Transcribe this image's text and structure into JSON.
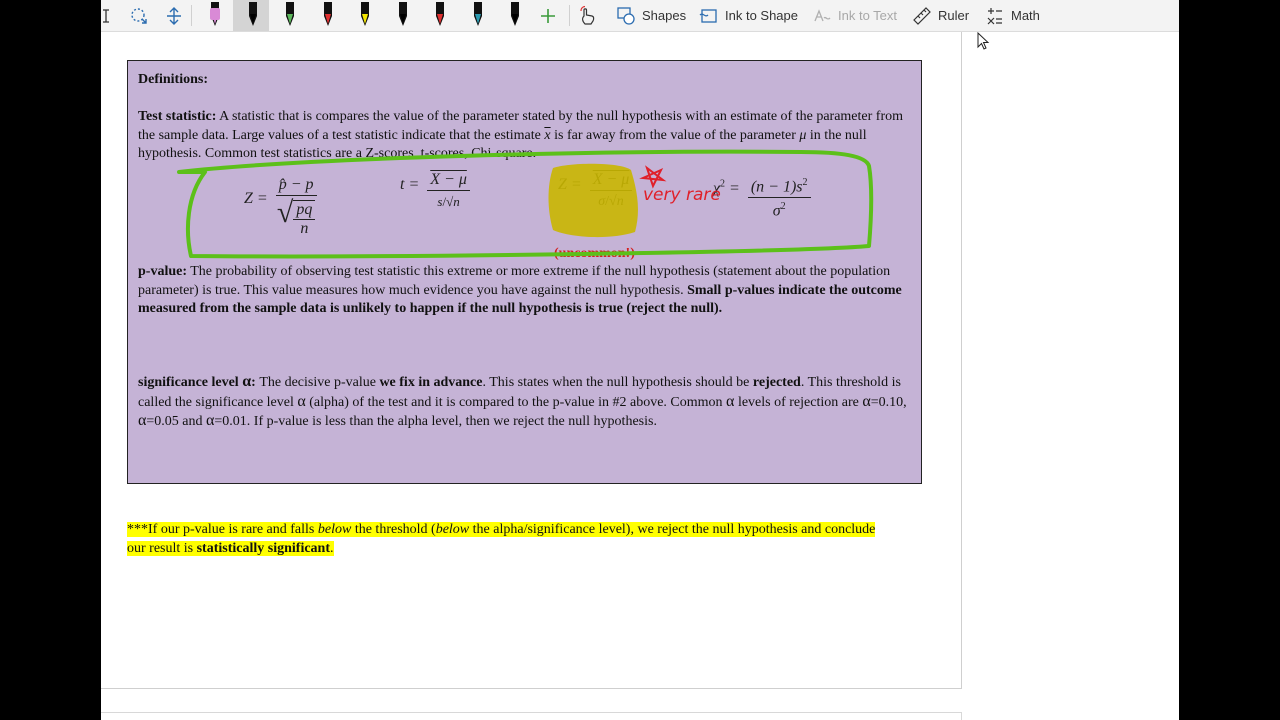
{
  "toolbar": {
    "shapes_label": "Shapes",
    "ink_to_shape_label": "Ink to Shape",
    "ink_to_text_label": "Ink to Text",
    "ruler_label": "Ruler",
    "math_label": "Math",
    "pens": [
      {
        "name": "pen-pink",
        "color": "#d98ad6"
      },
      {
        "name": "pen-black-selected",
        "color": "#000000"
      },
      {
        "name": "pen-green",
        "color": "#5cb85c"
      },
      {
        "name": "pen-red",
        "color": "#e03030"
      },
      {
        "name": "highlighter-yellow",
        "color": "#f3e600"
      },
      {
        "name": "pen-black-2",
        "color": "#000000"
      },
      {
        "name": "pen-red-2",
        "color": "#e03030"
      },
      {
        "name": "pen-teal",
        "color": "#2a9ab0"
      },
      {
        "name": "pen-black-3",
        "color": "#000000"
      }
    ]
  },
  "definitions": {
    "heading": "Definitions:",
    "test_statistic": {
      "term": "Test statistic:",
      "text_1": " A statistic that is compares the value of the parameter stated by the null hypothesis with an estimate of the parameter from the sample data.  Large values of a test statistic indicate that the estimate ",
      "xbar": "x",
      "text_2": "  is far away from the value of the parameter  ",
      "mu": "μ",
      "text_3": " in the null hypothesis.  Common test statistics are a Z-scores, t-scores, Chi-square."
    },
    "formulas": {
      "z_prop_lhs": "Z =",
      "z_prop_num": "p̂ − p",
      "z_prop_den": "pq",
      "z_prop_den_n": "n",
      "t_lhs": "t =",
      "t_num": "X − μ",
      "t_den_s": "s",
      "t_den_n": "n",
      "z_mean_lhs": "Z =",
      "z_mean_num": "X − μ",
      "z_mean_den_sigma": "σ",
      "z_mean_den_n": "n",
      "chi_lhs": "χ",
      "chi_sup": "2",
      "chi_eq": " =",
      "chi_num": "(n − 1)s",
      "chi_num_sup": "2",
      "chi_den": "σ",
      "chi_den_sup": "2",
      "uncommon": "(uncommon!)"
    },
    "p_value": {
      "term": "p-value:",
      "text_1": "  The probability of observing  test statistic this extreme or more extreme if the null hypothesis (statement about the population parameter) is true.  This value measures how much evidence you have against the null hypothesis.  ",
      "bold_text": "Small p-values indicate the outcome measured from the sample data is unlikely to happen if the null hypothesis is true (reject the null)."
    },
    "significance": {
      "term": "significance level ",
      "alpha": "α",
      "colon": ":",
      "text_1": "  The decisive p-value ",
      "bold_1": "we fix in advance",
      "text_2": ".  This states when the null hypothesis should be ",
      "bold_2": "rejected",
      "text_3": ".  This threshold is called the significance level ",
      "alpha_2": "α",
      "text_4": " (alpha) of the test and it is compared to the p-value in #2 above.  Common ",
      "alpha_3": "α",
      "text_5": " levels of rejection are ",
      "alpha_4": "α",
      "text_6": "=0.10, ",
      "alpha_5": "α",
      "text_7": "=0.05 and ",
      "alpha_6": "α",
      "text_8": "=0.01. If p-value is less than the alpha level, then we reject the null hypothesis."
    }
  },
  "ink": {
    "very_rare": "very rare"
  },
  "footnote": {
    "text_1": "***If our p-value is rare and falls ",
    "italic_1": "below",
    "text_2": " the threshold (",
    "italic_2": "below",
    "text_3": " the alpha/significance level), we reject the null hypothesis and conclude our result is ",
    "bold_1": "statistically significant",
    "text_4": "."
  }
}
